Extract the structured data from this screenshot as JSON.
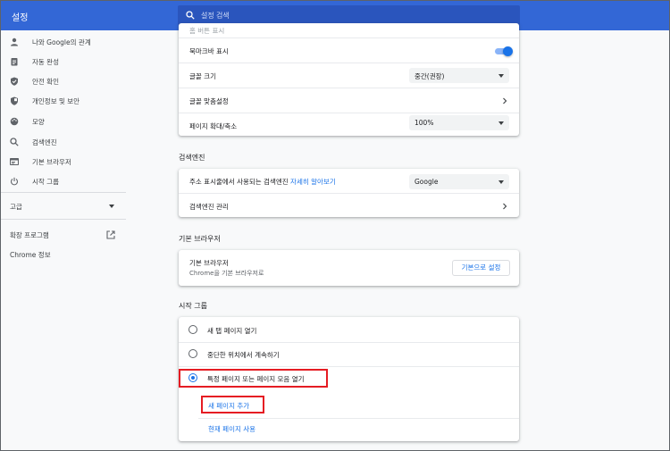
{
  "header": {
    "title": "설정",
    "search_placeholder": "설정 검색"
  },
  "sidebar": {
    "items": [
      {
        "label": "나와 Google의 관계",
        "icon": "person-icon"
      },
      {
        "label": "자동 완성",
        "icon": "clipboard-icon"
      },
      {
        "label": "안전 확인",
        "icon": "shield-check-icon"
      },
      {
        "label": "개인정보 및 보안",
        "icon": "shield-lock-icon"
      },
      {
        "label": "모양",
        "icon": "palette-icon"
      },
      {
        "label": "검색엔진",
        "icon": "search-icon"
      },
      {
        "label": "기본 브라우저",
        "icon": "browser-window-icon"
      },
      {
        "label": "시작 그룹",
        "icon": "power-icon"
      }
    ],
    "advanced_label": "고급",
    "extensions_label": "확장 프로그램",
    "about_label": "Chrome 정보"
  },
  "appearance": {
    "partial_row": "홈 버튼 표시",
    "bookmarks_bar": {
      "label": "북마크바 표시",
      "enabled": true
    },
    "font_size": {
      "label": "글꼴 크기",
      "value": "중간(권장)"
    },
    "customize_fonts": {
      "label": "글꼴 맞춤설정"
    },
    "page_zoom": {
      "label": "페이지 확대/축소",
      "value": "100%"
    }
  },
  "search_engine": {
    "title": "검색엔진",
    "row_label": "주소 표시줄에서 사용되는 검색엔진",
    "learn_more": "자세히 알아보기",
    "value": "Google",
    "manage_label": "검색엔진 관리"
  },
  "default_browser": {
    "title": "기본 브라우저",
    "label": "기본 브라우저",
    "sublabel": "Chrome을 기본 브라우저로",
    "button": "기본으로 설정"
  },
  "startup": {
    "title": "시작 그룹",
    "options": [
      {
        "label": "새 탭 페이지 열기",
        "checked": false
      },
      {
        "label": "중단한 위치에서 계속하기",
        "checked": false
      },
      {
        "label": "특정 페이지 또는 페이지 모음 열기",
        "checked": true
      }
    ],
    "add_page": "새 페이지 추가",
    "use_current": "현재 페이지 사용"
  },
  "colors": {
    "accent": "#1a73e8",
    "header": "#3367d6",
    "highlight": "#e51c23"
  }
}
